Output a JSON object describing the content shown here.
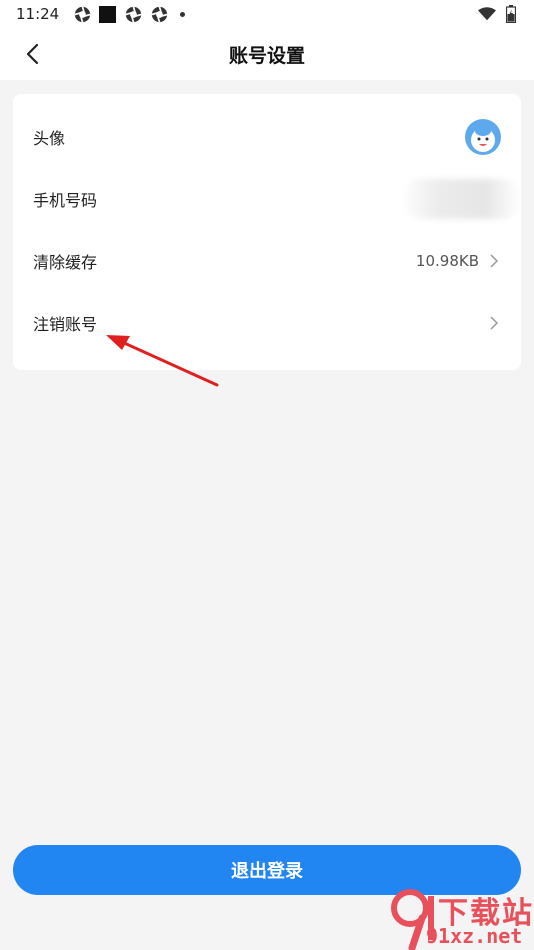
{
  "status_bar": {
    "time": "11:24",
    "icons": [
      "gear-shutter-icon",
      "black-square-icon",
      "gear-shutter-icon",
      "gear-shutter-icon",
      "dot-icon"
    ],
    "right_icons": [
      "wifi-icon",
      "battery-charging-icon"
    ]
  },
  "nav": {
    "title": "账号设置",
    "back_icon": "chevron-left-icon"
  },
  "settings": {
    "items": [
      {
        "label": "头像",
        "type": "avatar"
      },
      {
        "label": "手机号码",
        "type": "blurred"
      },
      {
        "label": "清除缓存",
        "value": "10.98KB",
        "type": "chevron"
      },
      {
        "label": "注销账号",
        "type": "chevron"
      }
    ]
  },
  "annotation": {
    "color": "#e02020"
  },
  "logout": {
    "label": "退出登录",
    "color": "#2185f2"
  },
  "watermark": {
    "top_text": "下载站",
    "bottom_text": "91xz.net",
    "color": "#e8505b"
  }
}
